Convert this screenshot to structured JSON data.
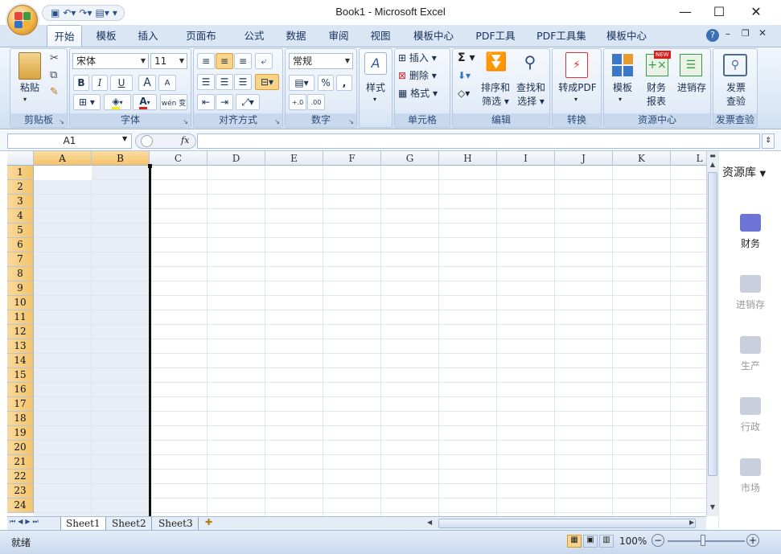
{
  "window": {
    "title": "Book1 - Microsoft Excel",
    "minimize": "—",
    "maximize": "☐",
    "close": "✕"
  },
  "quick_access": [
    "save-icon",
    "undo-icon",
    "redo-icon",
    "paste-icon",
    "customize-icon"
  ],
  "tabs": [
    {
      "label": "开始",
      "active": true
    },
    {
      "label": "模板"
    },
    {
      "label": "插入"
    },
    {
      "label": "页面布局"
    },
    {
      "label": "公式"
    },
    {
      "label": "数据"
    },
    {
      "label": "审阅"
    },
    {
      "label": "视图"
    },
    {
      "label": "模板中心"
    },
    {
      "label": "PDF工具"
    },
    {
      "label": "PDF工具集"
    },
    {
      "label": "模板中心"
    }
  ],
  "ribbon": {
    "clipboard": {
      "label": "剪贴板",
      "paste": "粘贴"
    },
    "font": {
      "label": "字体",
      "name": "宋体",
      "size": "11",
      "bold": "B",
      "italic": "I",
      "underline": "U",
      "grow": "A",
      "shrink": "A",
      "wen": "wén 变"
    },
    "alignment": {
      "label": "对齐方式"
    },
    "number": {
      "label": "数字",
      "format": "常规",
      "percent": "%",
      "comma": ","
    },
    "style": {
      "label": "样式"
    },
    "cells": {
      "label": "单元格",
      "insert": "插入",
      "delete": "删除",
      "format": "格式"
    },
    "editing": {
      "label": "编辑",
      "sort": "排序和",
      "sort2": "筛选",
      "find": "查找和",
      "find2": "选择"
    },
    "convert": {
      "label": "转换",
      "topdf": "转成PDF"
    },
    "resource": {
      "label": "资源中心",
      "template": "模板",
      "finance": "财务",
      "finance2": "报表",
      "inventory": "进销存",
      "new_badge": "NEW"
    },
    "invoice": {
      "label": "发票查验",
      "btn1": "发票",
      "btn2": "查验"
    }
  },
  "formula": {
    "namebox": "A1",
    "fx": "fx",
    "value": ""
  },
  "columns": [
    "A",
    "B",
    "C",
    "D",
    "E",
    "F",
    "G",
    "H",
    "I",
    "J",
    "K",
    "L"
  ],
  "rows": [
    "1",
    "2",
    "3",
    "4",
    "5",
    "6",
    "7",
    "8",
    "9",
    "10",
    "11",
    "12",
    "13",
    "14",
    "15",
    "16",
    "17",
    "18",
    "19",
    "20",
    "21",
    "22",
    "23",
    "24"
  ],
  "sheets": [
    "Sheet1",
    "Sheet2",
    "Sheet3"
  ],
  "side_panel": {
    "title": "资源库",
    "items": [
      {
        "label": "财务",
        "icon": "wallet-icon",
        "active": true
      },
      {
        "label": "进销存",
        "icon": "swap-icon"
      },
      {
        "label": "生产",
        "icon": "production-icon"
      },
      {
        "label": "行政",
        "icon": "bank-icon"
      },
      {
        "label": "市场",
        "icon": "bar-chart-icon"
      }
    ]
  },
  "status": {
    "ready": "就绪",
    "zoom": "100%"
  }
}
